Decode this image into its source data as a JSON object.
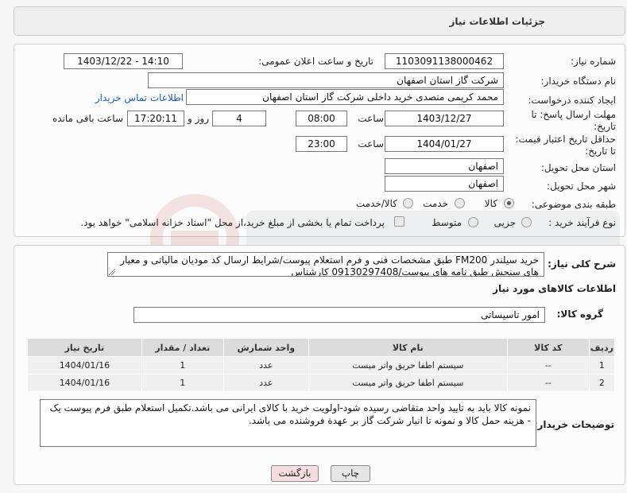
{
  "header": {
    "title": "جزئیات اطلاعات نیاز"
  },
  "form": {
    "need_number_label": "شماره نیاز:",
    "need_number": "1103091138000462",
    "announce_label": "تاریخ و ساعت اعلان عمومی:",
    "announce_value": "1403/12/22 - 14:10",
    "buyer_label": "نام دستگاه خریدار:",
    "buyer_value": "شرکت گاز استان اصفهان",
    "requester_label": "ایجاد کننده درخواست:",
    "requester_value": "محمد کریمی متصدی خرید داخلی شرکت گاز استان اصفهان",
    "contact_link": "اطلاعات تماس خریدار",
    "deadline_label": "مهلت ارسال پاسخ: تا تاریخ:",
    "deadline_date": "1403/12/27",
    "time_label": "ساعت",
    "deadline_time": "08:00",
    "days_value": "4",
    "days_label": "روز و",
    "remaining_time": "17:20:11",
    "remaining_label": "ساعت باقی مانده",
    "price_validity_label": "حداقل تاریخ اعتبار قیمت: تا تاریخ:",
    "price_validity_date": "1404/01/27",
    "price_validity_time": "23:00",
    "province_label": "استان محل تحویل:",
    "province_value": "اصفهان",
    "city_label": "شهر محل تحویل:",
    "city_value": "اصفهان",
    "category_label": "طبقه بندی موضوعی:",
    "category_options": [
      "کالا",
      "خدمت",
      "کالا/خدمت"
    ],
    "process_label": "نوع فرآیند خرید :",
    "process_options": [
      "جزیی",
      "متوسط"
    ],
    "payment_note": "پرداخت تمام یا بخشی از مبلغ خرید،از محل \"اسناد خزانه اسلامی\" خواهد بود."
  },
  "description": {
    "label": "شرح کلی نیاز:",
    "text": "خرید سیلندر FM200  طبق مشخصات فنی و فرم استعلام پیوست/شرایط  ارسال کد مودیان مالیاتی و معیار های سنجش طبق نامه های پیوست/09130297408 کارشناس"
  },
  "goods": {
    "section_title": "اطلاعات کالاهای مورد نیاز",
    "group_label": "گروه کالا:",
    "group_value": "امور تاسیساتی",
    "columns": [
      "ردیف",
      "کد کالا",
      "نام کالا",
      "واحد شمارش",
      "تعداد / مقدار",
      "تاریخ نیاز"
    ],
    "rows": [
      [
        "1",
        "--",
        "سیستم اطفا حریق واتر میست",
        "عدد",
        "1",
        "1404/01/16"
      ],
      [
        "2",
        "--",
        "سیستم اطفا حریق واتر میست",
        "عدد",
        "1",
        "1404/01/16"
      ]
    ]
  },
  "buyer_notes": {
    "label": "توضیحات خریدار:",
    "text": "نمونه کالا باید به تایید واحد متقاضی رسیده شود-اولویت خرید با کالای ایرانی می باشد.تکمیل استعلام طبق فرم پیوست یک - هزینه حمل کالا و نمونه تا انبار شرکت گاز بر عهدة فروشنده می باشد."
  },
  "buttons": {
    "print": "چاپ",
    "back": "بازگشت"
  },
  "colors": {
    "link": "#1b5fb3",
    "back_button": "#f7dede"
  }
}
